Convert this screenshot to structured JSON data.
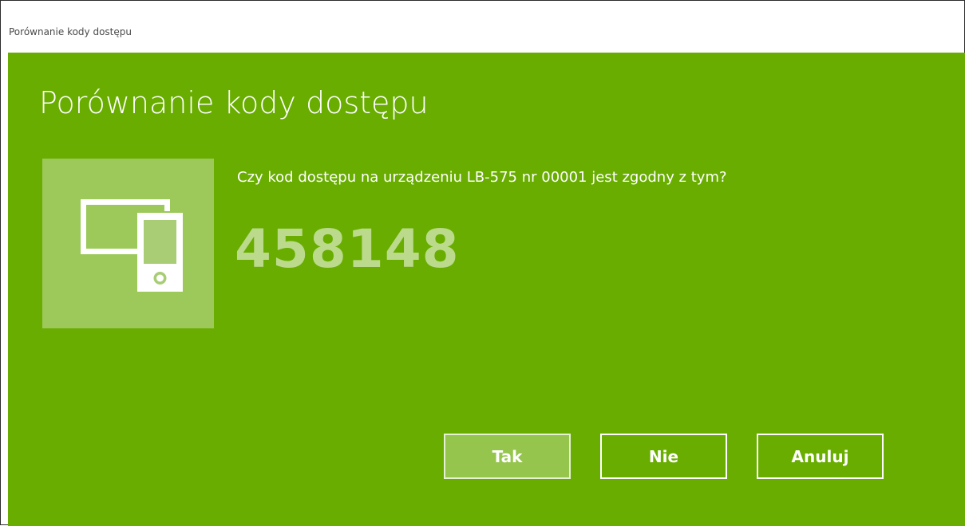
{
  "window": {
    "title": "Porównanie kody dostępu"
  },
  "dialog": {
    "heading": "Porównanie kody dostępu",
    "question": "Czy kod dostępu na urządzeniu LB-575 nr 00001 jest zgodny z tym?",
    "passcode": "458148",
    "icon": "devices-icon"
  },
  "buttons": {
    "yes_label": "Tak",
    "no_label": "Nie",
    "cancel_label": "Anuluj"
  },
  "colors": {
    "accent_background": "#68ad00",
    "text": "#ffffff"
  }
}
